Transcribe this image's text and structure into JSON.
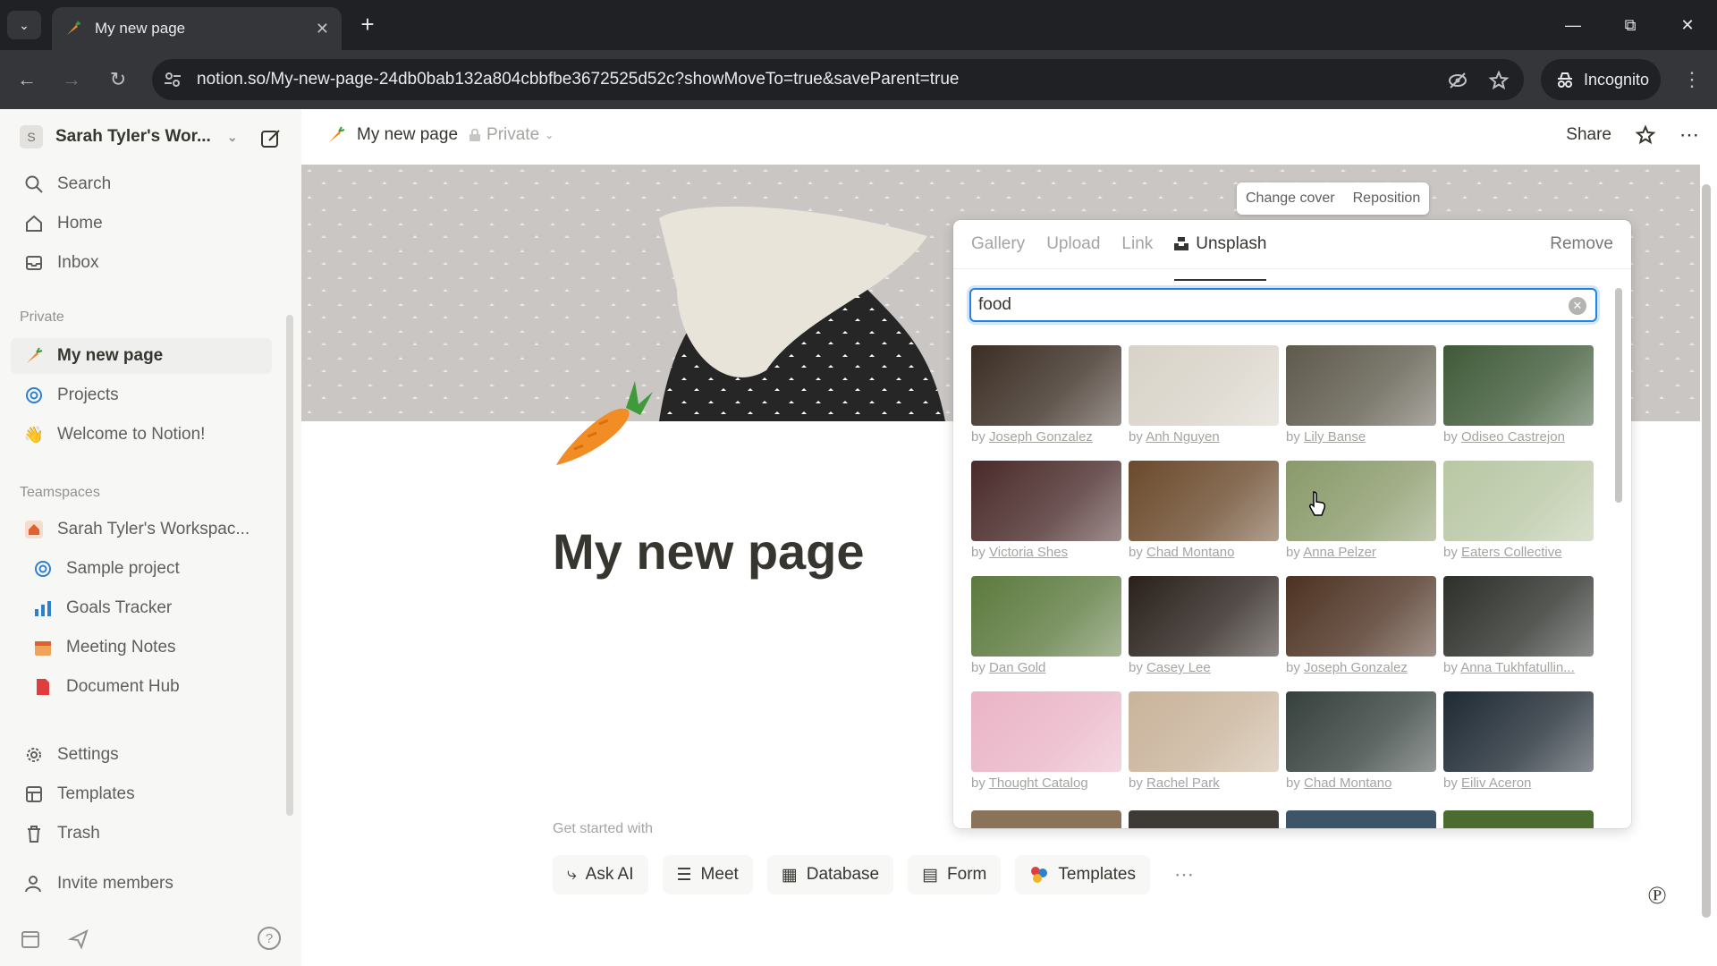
{
  "browser": {
    "tab_title": "My new page",
    "url": "notion.so/My-new-page-24db0bab132a804cbbfbe3672525d52c?showMoveTo=true&saveParent=true",
    "incognito_label": "Incognito"
  },
  "sidebar": {
    "workspace": "Sarah Tyler's Wor...",
    "workspace_initial": "S",
    "nav": [
      {
        "label": "Search",
        "icon": "search-icon"
      },
      {
        "label": "Home",
        "icon": "home-icon"
      },
      {
        "label": "Inbox",
        "icon": "inbox-icon"
      }
    ],
    "private_heading": "Private",
    "private": [
      {
        "label": "My new page",
        "icon": "carrot-icon",
        "active": true
      },
      {
        "label": "Projects",
        "icon": "target-icon"
      },
      {
        "label": "Welcome to Notion!",
        "icon": "wave-icon"
      }
    ],
    "teamspaces_heading": "Teamspaces",
    "teamspace": "Sarah Tyler's Workspac...",
    "team_items": [
      {
        "label": "Sample project",
        "icon": "target-icon"
      },
      {
        "label": "Goals Tracker",
        "icon": "chart-icon"
      },
      {
        "label": "Meeting Notes",
        "icon": "calendar-icon"
      },
      {
        "label": "Document Hub",
        "icon": "doc-icon"
      }
    ],
    "settings": [
      {
        "label": "Settings",
        "icon": "gear-icon"
      },
      {
        "label": "Templates",
        "icon": "templates-icon"
      },
      {
        "label": "Trash",
        "icon": "trash-icon"
      }
    ],
    "invite": "Invite members",
    "help": "?"
  },
  "topbar": {
    "breadcrumb": "My new page",
    "privacy": "Private",
    "share": "Share"
  },
  "cover": {
    "change_cover": "Change cover",
    "reposition": "Reposition"
  },
  "page": {
    "title": "My new page",
    "get_started": "Get started with",
    "actions": [
      {
        "label": "Ask AI",
        "icon": "ai-icon"
      },
      {
        "label": "Meet",
        "icon": "meet-icon"
      },
      {
        "label": "Database",
        "icon": "table-icon"
      },
      {
        "label": "Form",
        "icon": "form-icon"
      },
      {
        "label": "Templates",
        "icon": "templates-icon"
      }
    ]
  },
  "cover_picker": {
    "tabs": [
      "Gallery",
      "Upload",
      "Link",
      "Unsplash"
    ],
    "active_tab": "Unsplash",
    "remove": "Remove",
    "search_value": "food",
    "photos": [
      {
        "by": "by ",
        "author": "Joseph Gonzalez",
        "color": "#3b2e24"
      },
      {
        "by": "by ",
        "author": "Anh Nguyen",
        "color": "#d8d3c8"
      },
      {
        "by": "by ",
        "author": "Lily Banse",
        "color": "#5e5a4c"
      },
      {
        "by": "by ",
        "author": "Odiseo Castrejon",
        "color": "#3f5a38"
      },
      {
        "by": "by ",
        "author": "Victoria Shes",
        "color": "#4a2a2a"
      },
      {
        "by": "by ",
        "author": "Chad Montano",
        "color": "#6b4a2c"
      },
      {
        "by": "by ",
        "author": "Anna Pelzer",
        "color": "#8a9a6a"
      },
      {
        "by": "by ",
        "author": "Eaters Collective",
        "color": "#b9c7a4"
      },
      {
        "by": "by ",
        "author": "Dan Gold",
        "color": "#5c7a3e"
      },
      {
        "by": "by ",
        "author": "Casey Lee",
        "color": "#2a211c"
      },
      {
        "by": "by ",
        "author": "Joseph Gonzalez",
        "color": "#4d3222"
      },
      {
        "by": "by ",
        "author": "Anna Tukhfatullin...",
        "color": "#2c2f2a"
      },
      {
        "by": "by ",
        "author": "Thought Catalog",
        "color": "#eab4c6"
      },
      {
        "by": "by ",
        "author": "Rachel Park",
        "color": "#c9b39a"
      },
      {
        "by": "by ",
        "author": "Chad Montano",
        "color": "#36403c"
      },
      {
        "by": "by ",
        "author": "Eiliv Aceron",
        "color": "#1f2a33"
      }
    ]
  }
}
